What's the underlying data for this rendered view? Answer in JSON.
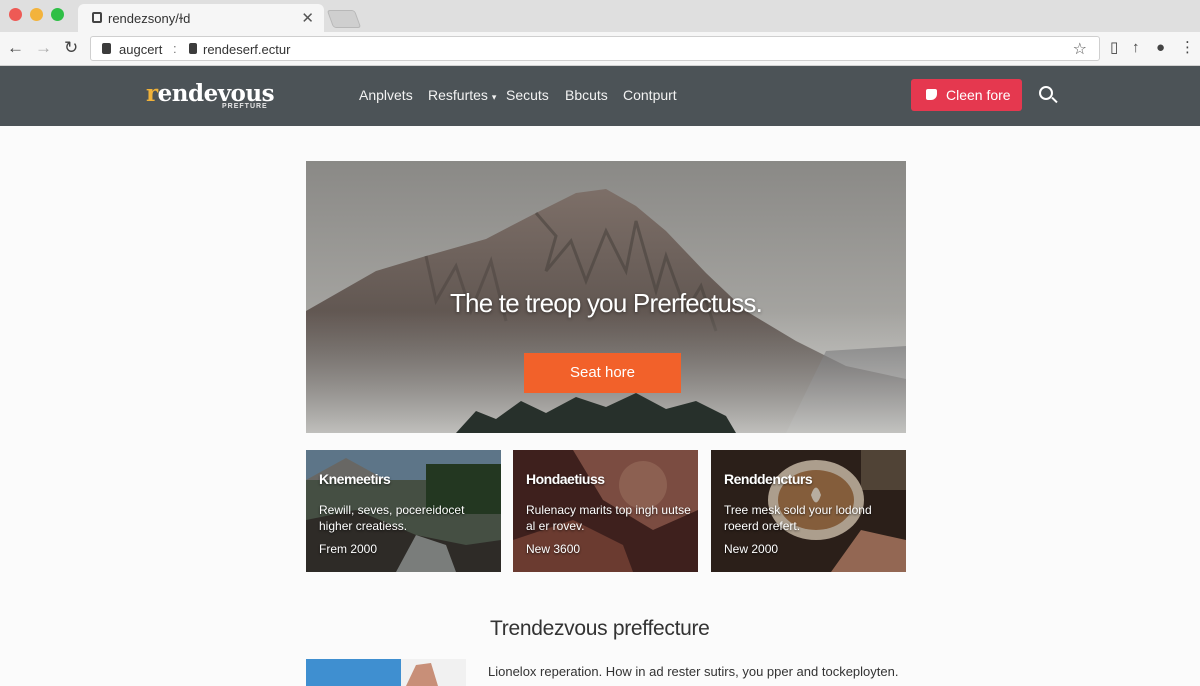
{
  "browser": {
    "tab_title": "rendezsony/ɫd",
    "tab_close": "✕",
    "address": {
      "secure_label": "augcert",
      "separator": ":",
      "url": "rendeserf.ectur"
    }
  },
  "header": {
    "logo": {
      "initial": "r",
      "rest": "endevous",
      "tagline": "PREFTURE"
    },
    "nav": [
      "Anplvets",
      "Resfurtes",
      "Secuts",
      "Bbcuts",
      "Contpurt"
    ],
    "nav_dropdown_index": 1,
    "cta_label": "Cleen fore",
    "colors": {
      "header_bg": "#4c5357",
      "cta_bg": "#e5384f",
      "logo_accent": "#f0b23a"
    }
  },
  "hero": {
    "title": "The te treop you Prerfectuss.",
    "button_label": "Seat hore",
    "button_color": "#f2612a"
  },
  "cards": [
    {
      "title": "Knemeetirs",
      "text": "Rewill, seves, pocereidocet higher creatiess.",
      "meta": "Frem 2000"
    },
    {
      "title": "Hondaetiuss",
      "text": "Rulenacy marits top ingh uutse al er rovev.",
      "meta": "New 3600"
    },
    {
      "title": "Renddencturs",
      "text": "Tree mesk sold your lodond roeerd orefert.",
      "meta": "New 2000"
    }
  ],
  "section": {
    "title": "Trendezvous preffecture",
    "text": "Lionelox reperation. How in ad rester sutirs, you pper and tockeployten."
  }
}
